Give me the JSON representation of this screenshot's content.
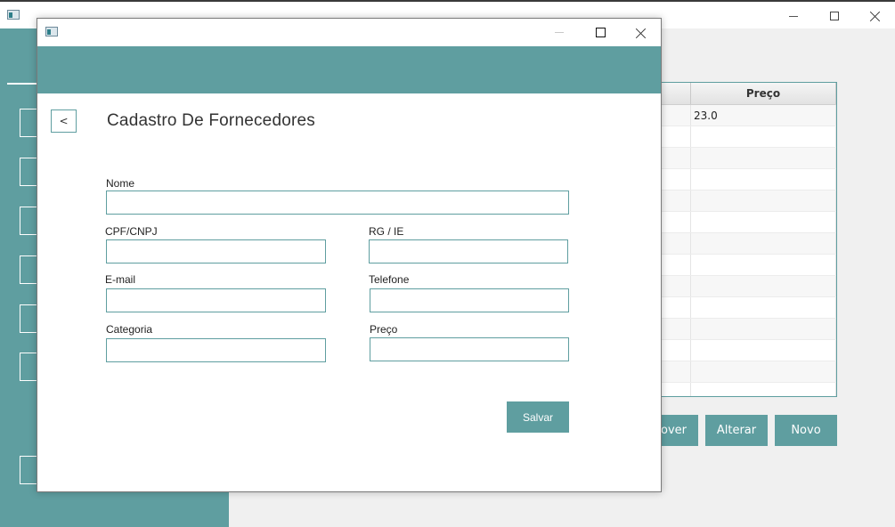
{
  "background_window": {
    "table": {
      "columns": [
        "",
        "Preço"
      ],
      "rows": [
        [
          "",
          "23.0"
        ],
        [
          "",
          ""
        ],
        [
          "",
          ""
        ],
        [
          "",
          ""
        ],
        [
          "",
          ""
        ],
        [
          "",
          ""
        ],
        [
          "",
          ""
        ],
        [
          "",
          ""
        ],
        [
          "",
          ""
        ],
        [
          "",
          ""
        ],
        [
          "",
          ""
        ],
        [
          "",
          ""
        ],
        [
          "",
          ""
        ],
        [
          "",
          ""
        ]
      ]
    },
    "buttons": {
      "remove_label": "mover",
      "alter_label": "Alterar",
      "new_label": "Novo"
    }
  },
  "dialog": {
    "back_label": "<",
    "title": "Cadastro De Fornecedores",
    "fields": {
      "nome": {
        "label": "Nome",
        "value": ""
      },
      "cpf_cnpj": {
        "label": "CPF/CNPJ",
        "value": ""
      },
      "rg_ie": {
        "label": "RG / IE",
        "value": ""
      },
      "email": {
        "label": "E-mail",
        "value": ""
      },
      "telefone": {
        "label": "Telefone",
        "value": ""
      },
      "categoria": {
        "label": "Categoria",
        "value": ""
      },
      "preco": {
        "label": "Preço",
        "value": ""
      }
    },
    "save_label": "Salvar"
  },
  "colors": {
    "accent": "#5f9ea0",
    "background": "#f0f0f0",
    "surface": "#ffffff"
  },
  "icons": [
    "app-icon",
    "minimize-icon",
    "maximize-icon",
    "close-icon"
  ]
}
